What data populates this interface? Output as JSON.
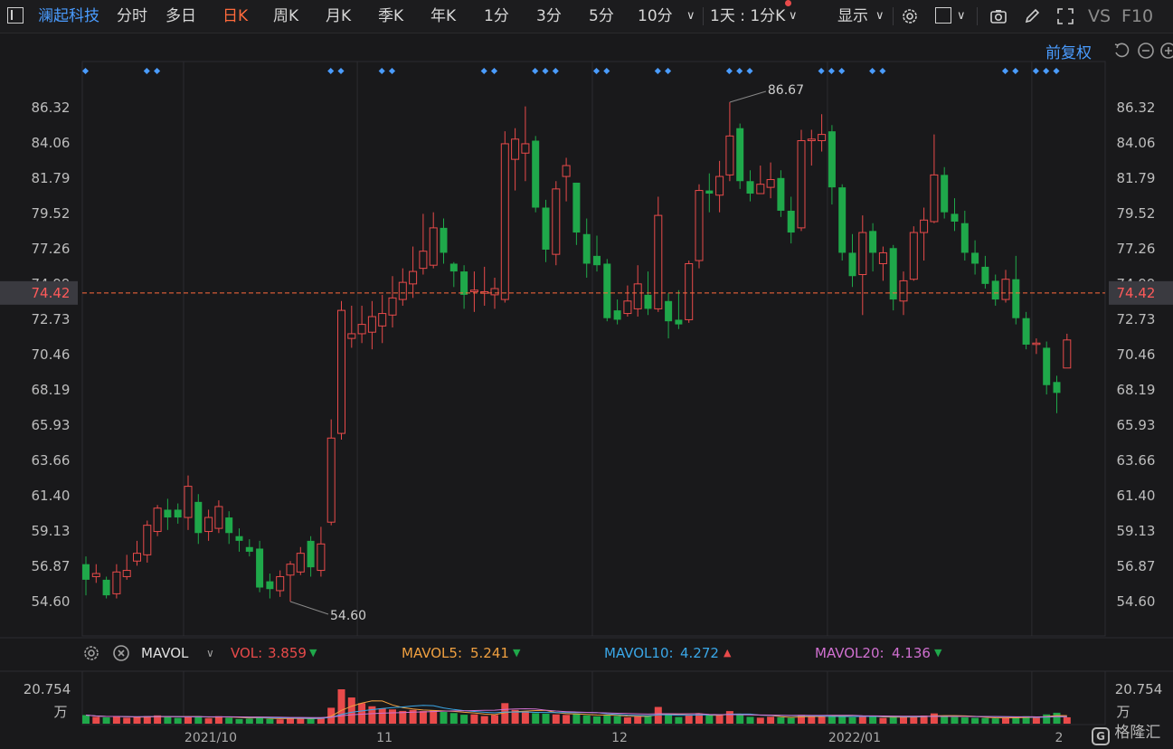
{
  "toolbar": {
    "stock_name": "澜起科技",
    "tabs": [
      "分时",
      "多日",
      "日K",
      "周K",
      "月K",
      "季K",
      "年K",
      "1分",
      "3分",
      "5分",
      "10分"
    ],
    "active_tab": "日K",
    "interval_select": "1天 : 1分K",
    "display_label": "显示",
    "vs_label": "VS",
    "f10_label": "F10"
  },
  "adjust_label": "前复权",
  "price_panel": {
    "y_ticks": [
      "86.32",
      "84.06",
      "81.79",
      "79.52",
      "77.26",
      "74.99",
      "72.73",
      "70.46",
      "68.19",
      "65.93",
      "63.66",
      "61.40",
      "59.13",
      "56.87",
      "54.60"
    ],
    "current_price": "74.42",
    "max_label": "86.67",
    "min_label": "54.60",
    "x_labels": [
      "2021/10",
      "11",
      "12",
      "2022/01",
      "2"
    ]
  },
  "indicators": {
    "name": "MAVOL",
    "vol_label": "VOL:",
    "vol_value": "3.859",
    "mavol5_label": "MAVOL5:",
    "mavol5_value": "5.241",
    "mavol10_label": "MAVOL10:",
    "mavol10_value": "4.272",
    "mavol20_label": "MAVOL20:",
    "mavol20_value": "4.136"
  },
  "volume_panel": {
    "max_label": "20.754",
    "unit_label": "万"
  },
  "watermark": "格隆汇",
  "colors": {
    "up": "#e84a4a",
    "down": "#1fa84a",
    "accent": "#ff6a3c",
    "link": "#4a9cff",
    "mavol5": "#f0a040",
    "mavol10": "#3aa7e8",
    "mavol20": "#d070d0"
  },
  "chart_data": {
    "type": "candlestick",
    "ylim": [
      54.6,
      86.32
    ],
    "volume_max": 20.754,
    "candles": [
      [
        57.0,
        56.0,
        57.5,
        55.0,
        5.2
      ],
      [
        56.2,
        56.4,
        57.0,
        55.8,
        4.1
      ],
      [
        56.0,
        55.0,
        56.2,
        54.8,
        3.8
      ],
      [
        55.1,
        56.5,
        57.0,
        54.8,
        4.4
      ],
      [
        56.2,
        56.6,
        57.6,
        56.0,
        3.6
      ],
      [
        57.2,
        57.7,
        58.5,
        56.9,
        3.9
      ],
      [
        57.6,
        59.5,
        59.8,
        57.1,
        4.6
      ],
      [
        59.1,
        60.6,
        60.8,
        58.8,
        5.0
      ],
      [
        60.5,
        60.0,
        61.2,
        59.2,
        4.0
      ],
      [
        60.5,
        60.0,
        60.9,
        59.6,
        3.5
      ],
      [
        60.0,
        62.0,
        62.7,
        59.2,
        4.3
      ],
      [
        61.0,
        59.0,
        61.5,
        58.3,
        4.6
      ],
      [
        59.1,
        60.0,
        60.5,
        58.5,
        3.2
      ],
      [
        59.3,
        60.7,
        61.1,
        59.0,
        4.5
      ],
      [
        60.0,
        59.0,
        60.4,
        58.3,
        3.6
      ],
      [
        58.8,
        58.5,
        59.3,
        57.8,
        2.8
      ],
      [
        58.1,
        57.8,
        58.6,
        57.5,
        3.0
      ],
      [
        58.0,
        55.5,
        58.5,
        55.2,
        4.1
      ],
      [
        55.9,
        55.4,
        56.4,
        54.8,
        2.9
      ],
      [
        55.3,
        56.2,
        56.6,
        54.9,
        2.6
      ],
      [
        56.3,
        57.0,
        57.2,
        54.6,
        3.2
      ],
      [
        56.5,
        57.7,
        58.1,
        56.3,
        3.3
      ],
      [
        58.5,
        56.8,
        58.8,
        56.2,
        2.9
      ],
      [
        56.6,
        58.3,
        59.4,
        56.2,
        3.6
      ],
      [
        59.7,
        65.1,
        66.3,
        59.5,
        9.6
      ],
      [
        65.4,
        73.3,
        73.9,
        65.0,
        20.754
      ],
      [
        71.5,
        71.8,
        73.6,
        70.9,
        15.8
      ],
      [
        71.8,
        72.4,
        73.6,
        71.2,
        12.4
      ],
      [
        71.9,
        72.9,
        73.9,
        70.8,
        10.5
      ],
      [
        72.3,
        73.1,
        74.3,
        71.2,
        9.2
      ],
      [
        73.0,
        74.1,
        75.5,
        72.2,
        8.6
      ],
      [
        74.0,
        75.1,
        76.0,
        73.6,
        7.7
      ],
      [
        75.0,
        75.8,
        77.4,
        74.1,
        8.3
      ],
      [
        76.0,
        77.1,
        79.5,
        75.6,
        7.6
      ],
      [
        76.2,
        78.6,
        79.6,
        76.0,
        7.9
      ],
      [
        78.6,
        77.0,
        79.2,
        76.3,
        7.1
      ],
      [
        76.3,
        75.8,
        76.4,
        74.8,
        6.4
      ],
      [
        75.8,
        74.3,
        76.2,
        73.4,
        5.4
      ],
      [
        74.5,
        74.6,
        75.8,
        73.2,
        5.6
      ],
      [
        74.4,
        74.5,
        76.1,
        73.6,
        4.6
      ],
      [
        74.3,
        74.7,
        75.4,
        73.4,
        5.2
      ],
      [
        74.0,
        84.0,
        84.8,
        73.8,
        12.4
      ],
      [
        83.0,
        84.3,
        85.0,
        81.0,
        8.3
      ],
      [
        83.4,
        84.0,
        86.4,
        81.6,
        7.3
      ],
      [
        84.2,
        79.9,
        84.5,
        79.6,
        6.3
      ],
      [
        79.9,
        77.2,
        80.4,
        76.4,
        6.0
      ],
      [
        76.9,
        81.1,
        81.6,
        76.2,
        5.6
      ],
      [
        81.9,
        82.6,
        83.1,
        80.3,
        5.3
      ],
      [
        81.5,
        78.3,
        81.5,
        77.5,
        6.1
      ],
      [
        78.2,
        76.3,
        79.2,
        75.4,
        5.0
      ],
      [
        76.8,
        76.2,
        78.1,
        75.8,
        4.4
      ],
      [
        76.3,
        72.8,
        76.6,
        72.6,
        5.0
      ],
      [
        73.3,
        72.7,
        74.0,
        72.4,
        4.6
      ],
      [
        73.1,
        73.9,
        74.9,
        72.9,
        3.8
      ],
      [
        73.4,
        75.0,
        76.2,
        72.9,
        4.3
      ],
      [
        74.3,
        73.4,
        75.8,
        73.0,
        4.5
      ],
      [
        73.4,
        79.4,
        80.6,
        73.2,
        10.1
      ],
      [
        73.9,
        72.6,
        74.4,
        71.5,
        5.5
      ],
      [
        72.7,
        72.4,
        74.6,
        72.1,
        4.0
      ],
      [
        72.7,
        76.3,
        76.5,
        72.5,
        5.1
      ],
      [
        76.5,
        81.0,
        81.4,
        76.0,
        5.9
      ],
      [
        81.0,
        80.8,
        82.1,
        79.6,
        5.2
      ],
      [
        80.7,
        81.9,
        82.9,
        79.6,
        4.9
      ],
      [
        82.0,
        84.5,
        86.67,
        81.6,
        7.6
      ],
      [
        85.0,
        81.6,
        85.3,
        81.1,
        5.5
      ],
      [
        81.6,
        80.8,
        82.3,
        80.3,
        4.1
      ],
      [
        80.8,
        81.4,
        82.6,
        80.8,
        3.6
      ],
      [
        81.2,
        81.7,
        82.8,
        80.5,
        4.2
      ],
      [
        81.8,
        79.7,
        82.3,
        79.3,
        3.8
      ],
      [
        79.7,
        78.3,
        80.6,
        77.6,
        3.5
      ],
      [
        78.6,
        84.2,
        84.9,
        78.4,
        5.3
      ],
      [
        84.2,
        84.3,
        84.9,
        82.6,
        4.8
      ],
      [
        84.2,
        84.6,
        85.9,
        83.5,
        4.2
      ],
      [
        84.8,
        81.2,
        85.2,
        80.1,
        5.0
      ],
      [
        81.2,
        77.0,
        81.4,
        76.5,
        4.6
      ],
      [
        77.0,
        75.5,
        78.2,
        74.8,
        3.9
      ],
      [
        75.6,
        78.3,
        79.4,
        73.0,
        4.5
      ],
      [
        78.4,
        77.0,
        78.9,
        75.8,
        4.1
      ],
      [
        76.3,
        77.0,
        77.4,
        75.2,
        3.5
      ],
      [
        77.3,
        74.0,
        77.5,
        73.3,
        3.8
      ],
      [
        73.9,
        75.2,
        75.8,
        73.0,
        4.0
      ],
      [
        75.3,
        78.3,
        78.7,
        75.2,
        4.6
      ],
      [
        78.3,
        79.1,
        79.9,
        76.5,
        4.9
      ],
      [
        79.0,
        82.0,
        84.6,
        78.9,
        6.2
      ],
      [
        82.0,
        79.6,
        82.5,
        79.2,
        4.7
      ],
      [
        79.5,
        79.0,
        80.5,
        78.4,
        4.0
      ],
      [
        78.9,
        77.0,
        79.7,
        76.5,
        3.8
      ],
      [
        77.0,
        76.3,
        77.8,
        75.6,
        3.5
      ],
      [
        76.1,
        75.0,
        76.8,
        74.7,
        3.4
      ],
      [
        75.2,
        74.0,
        75.6,
        73.6,
        3.2
      ],
      [
        74.0,
        75.3,
        75.9,
        73.8,
        3.4
      ],
      [
        75.3,
        72.8,
        76.8,
        72.4,
        4.2
      ],
      [
        72.8,
        71.1,
        73.2,
        70.8,
        4.5
      ],
      [
        71.2,
        71.2,
        71.5,
        70.5,
        3.7
      ],
      [
        70.9,
        68.5,
        71.3,
        67.9,
        5.6
      ],
      [
        68.7,
        68.0,
        69.1,
        66.7,
        6.6
      ],
      [
        69.6,
        71.4,
        71.8,
        69.6,
        3.859
      ]
    ]
  }
}
